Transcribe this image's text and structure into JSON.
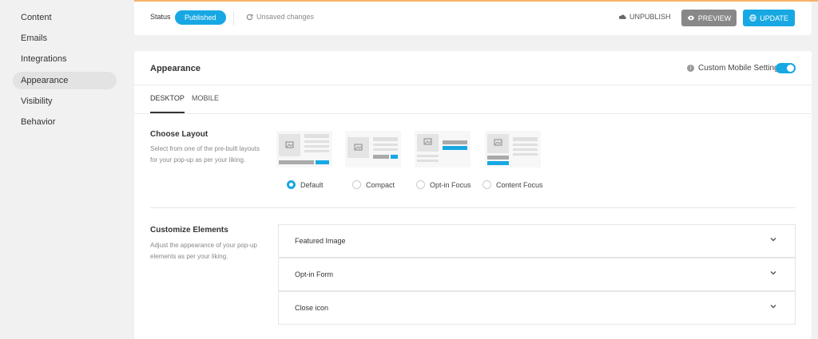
{
  "sidebar": {
    "items": [
      {
        "label": "Content",
        "active": false
      },
      {
        "label": "Emails",
        "active": false
      },
      {
        "label": "Integrations",
        "active": false
      },
      {
        "label": "Appearance",
        "active": true
      },
      {
        "label": "Visibility",
        "active": false
      },
      {
        "label": "Behavior",
        "active": false
      }
    ]
  },
  "status": {
    "label": "Status",
    "pill": "Published",
    "unsaved": "Unsaved changes",
    "unpublish": "UNPUBLISH",
    "preview": "PREVIEW",
    "update": "UPDATE"
  },
  "panel": {
    "title": "Appearance",
    "custom_mobile_label": "Custom Mobile Settings",
    "custom_mobile_enabled": true,
    "tabs": [
      {
        "label": "DESKTOP",
        "active": true
      },
      {
        "label": "MOBILE",
        "active": false
      }
    ],
    "choose_layout": {
      "title": "Choose Layout",
      "description": "Select from one of the pre-built layouts for your pop-up as per your liking.",
      "options": [
        {
          "label": "Default",
          "selected": true
        },
        {
          "label": "Compact",
          "selected": false
        },
        {
          "label": "Opt-in Focus",
          "selected": false
        },
        {
          "label": "Content Focus",
          "selected": false
        }
      ]
    },
    "customize": {
      "title": "Customize Elements",
      "description": "Adjust the appearance of your pop-up elements as per your liking.",
      "items": [
        {
          "label": "Featured Image"
        },
        {
          "label": "Opt-in Form"
        },
        {
          "label": "Close icon"
        }
      ]
    }
  },
  "colors": {
    "accent": "#17a8e3",
    "preview_bg": "#888888",
    "sidebar_bg": "#f1f1f1"
  }
}
